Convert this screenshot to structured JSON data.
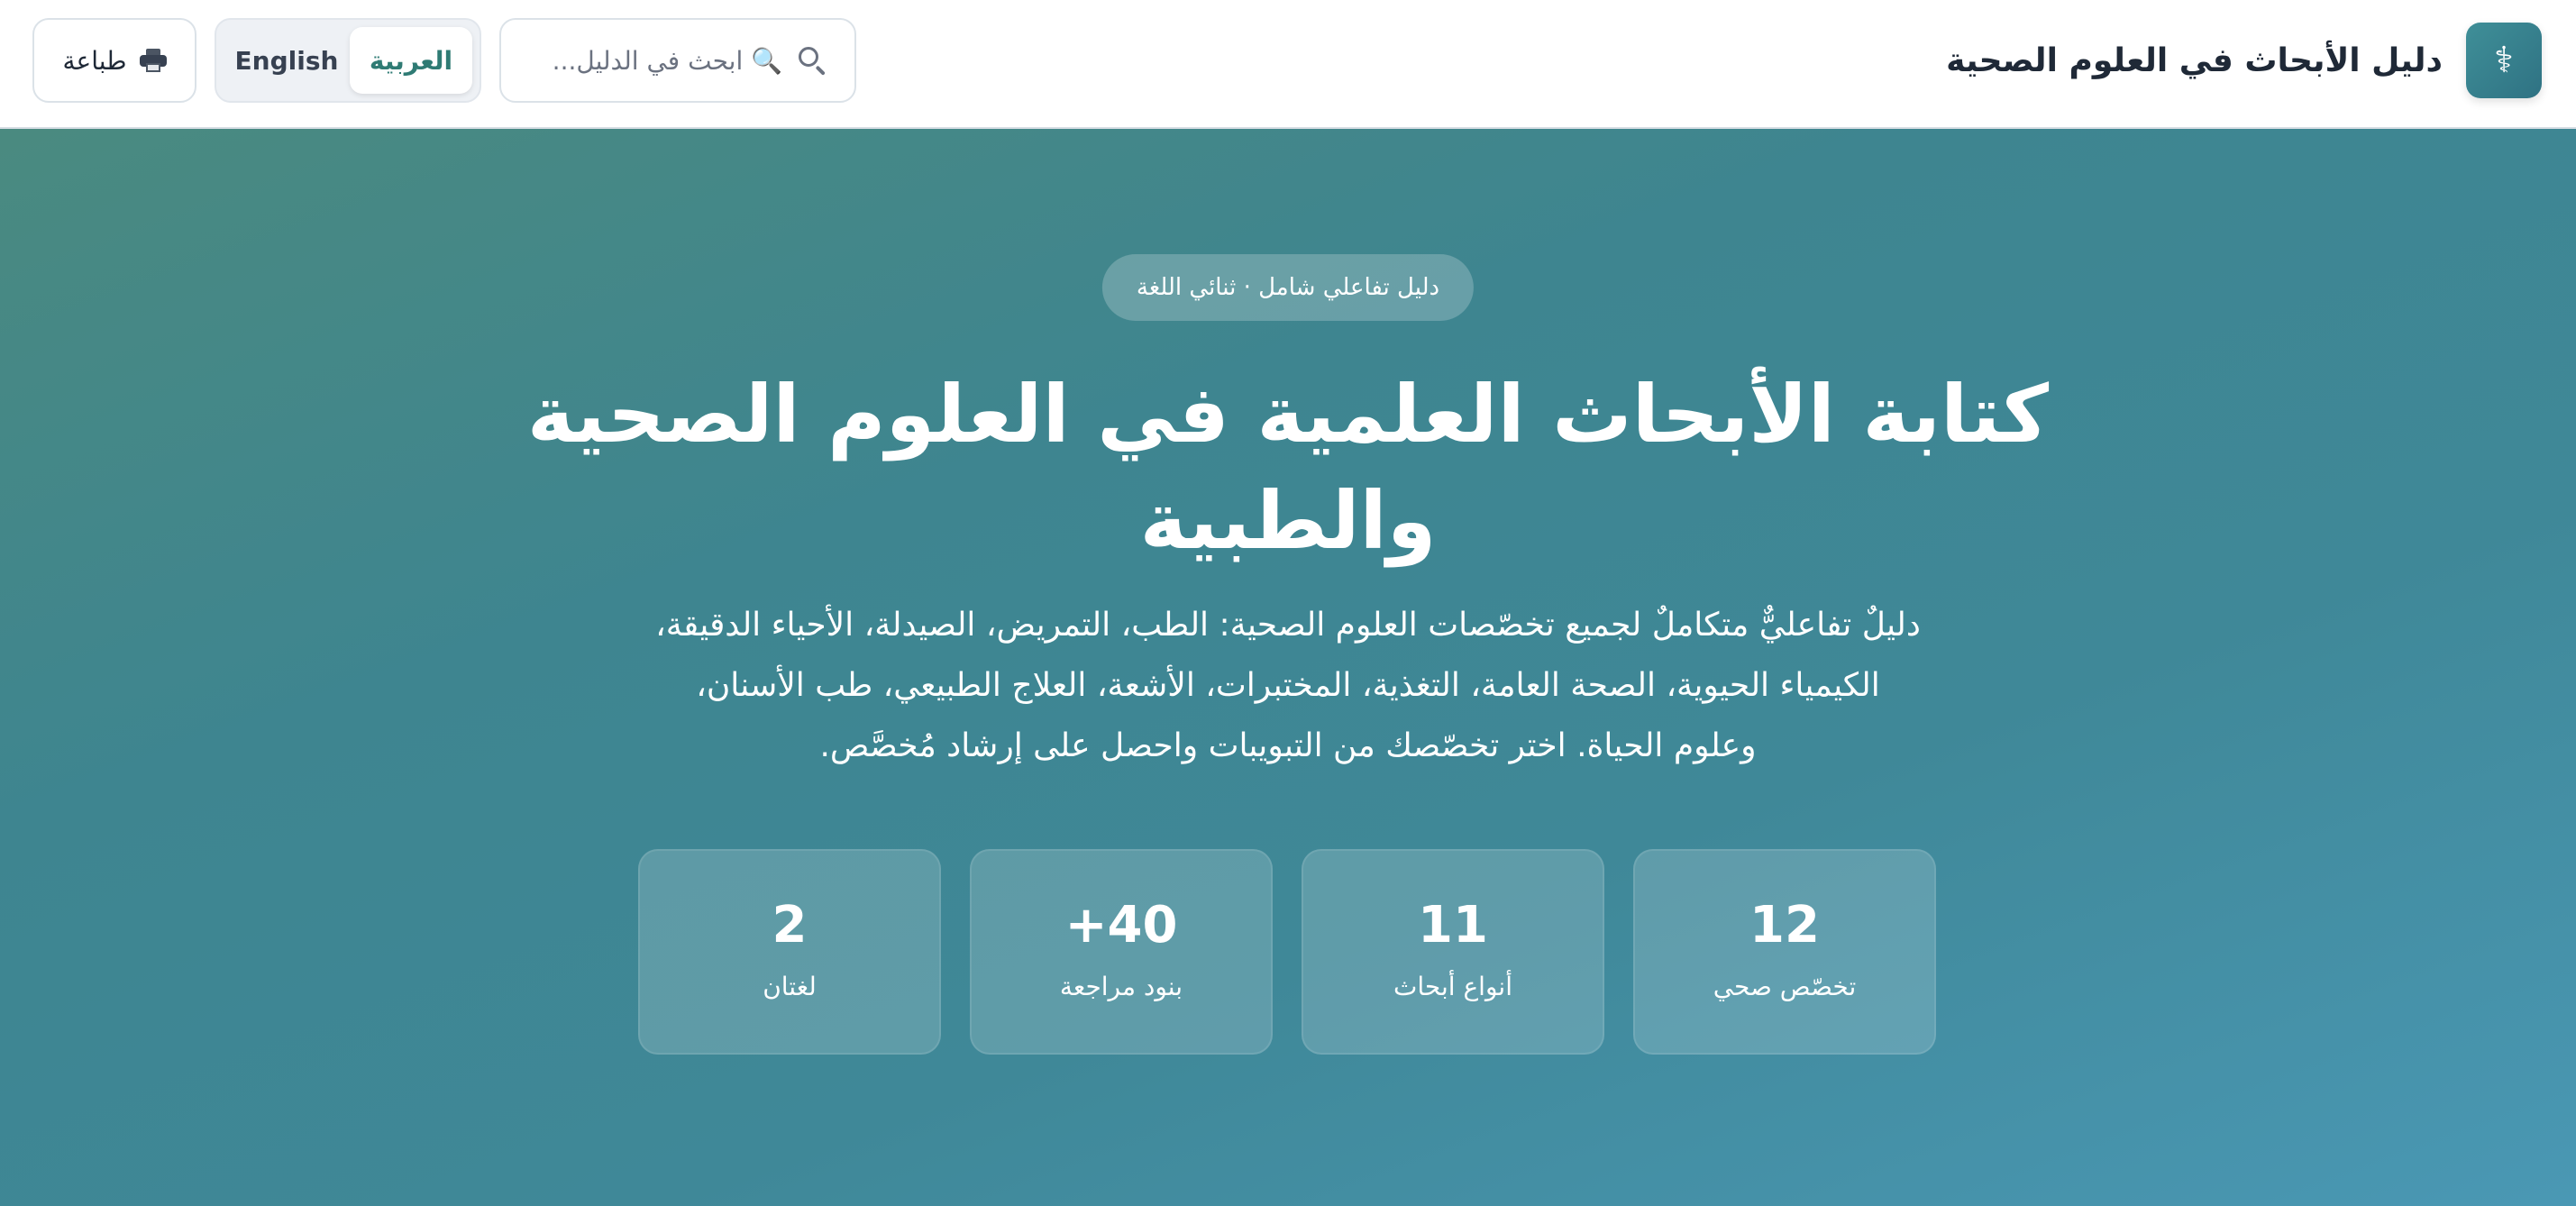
{
  "header": {
    "brand_icon": "⚕",
    "brand_title": "دليل الأبحاث في العلوم الصحية",
    "search": {
      "placeholder": "🔍 ابحث في الدليل...",
      "icon": "search-icon"
    },
    "language": {
      "arabic_label": "العربية",
      "english_label": "English",
      "active": "العربية"
    },
    "print": {
      "label": "طباعة",
      "icon": "printer-icon"
    }
  },
  "hero": {
    "badge": "دليل تفاعلي شامل · ثنائي اللغة",
    "title_line1": "كتابة الأبحاث العلمية في العلوم الصحية",
    "title_line2": "والطبية",
    "description_line1": "دليلٌ تفاعليٌّ متكاملٌ لجميع تخصّصات العلوم الصحية: الطب، التمريض، الصيدلة، الأحياء الدقيقة،",
    "description_line2": "الكيمياء الحيوية، الصحة العامة، التغذية، المختبرات، الأشعة، العلاج الطبيعي، طب الأسنان،",
    "description_line3": "وعلوم الحياة. اختر تخصّصك من التبويبات واحصل على إرشاد مُخصَّص.",
    "stats": [
      {
        "value": "12",
        "label": "تخصّص صحي"
      },
      {
        "value": "11",
        "label": "أنواع أبحاث"
      },
      {
        "value": "+40",
        "label": "بنود مراجعة"
      },
      {
        "value": "2",
        "label": "لغتان"
      }
    ]
  },
  "colors": {
    "accent": "#2f7b74",
    "brand_icon_bg": "#3f8f98",
    "hero_gradient_start": "#4a8a80",
    "hero_gradient_end": "#4a98b4"
  }
}
